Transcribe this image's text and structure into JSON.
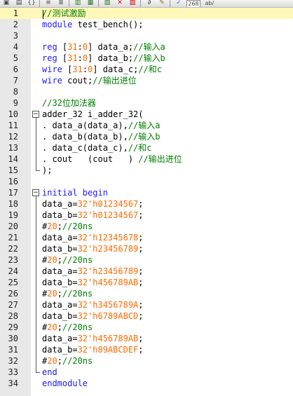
{
  "toolbar": {
    "icons": [
      "open-icon",
      "save-icon",
      "braces-icon",
      "indent-icon",
      "outdent-icon",
      "copy-icon",
      "paste-icon",
      "new-file-icon",
      "close-file-icon",
      "ftp-icon",
      "attach-icon",
      "highlight-icon",
      "check-icon",
      "calendar-icon",
      "find-replace-icon"
    ],
    "badge_label": "268",
    "find_replace_label": "ab/"
  },
  "editor": {
    "active_line": 1,
    "line_numbers": [
      "1",
      "2",
      "3",
      "4",
      "5",
      "6",
      "7",
      "8",
      "9",
      "10",
      "11",
      "12",
      "13",
      "14",
      "15",
      "16",
      "17",
      "18",
      "19",
      "20",
      "21",
      "22",
      "23",
      "24",
      "25",
      "26",
      "27",
      "28",
      "29",
      "30",
      "31",
      "32",
      "33",
      "34"
    ],
    "lines": [
      [
        {
          "t": "//测试激励",
          "c": "cm"
        }
      ],
      [
        {
          "t": "module",
          "c": "kw"
        },
        {
          "t": " test_bench();"
        }
      ],
      [],
      [
        {
          "t": "reg",
          "c": "kw"
        },
        {
          "t": " ["
        },
        {
          "t": "31",
          "c": "num"
        },
        {
          "t": ":"
        },
        {
          "t": "0",
          "c": "num"
        },
        {
          "t": "] data_a;"
        },
        {
          "t": "//输入a",
          "c": "cm"
        }
      ],
      [
        {
          "t": "reg",
          "c": "kw"
        },
        {
          "t": " ["
        },
        {
          "t": "31",
          "c": "num"
        },
        {
          "t": ":"
        },
        {
          "t": "0",
          "c": "num"
        },
        {
          "t": "] data_b;"
        },
        {
          "t": "//输入b",
          "c": "cm"
        }
      ],
      [
        {
          "t": "wire",
          "c": "kw"
        },
        {
          "t": " ["
        },
        {
          "t": "31",
          "c": "num"
        },
        {
          "t": ":"
        },
        {
          "t": "0",
          "c": "num"
        },
        {
          "t": "] data_c;"
        },
        {
          "t": "//和c",
          "c": "cm"
        }
      ],
      [
        {
          "t": "wire",
          "c": "kw"
        },
        {
          "t": " cout;"
        },
        {
          "t": "//输出进位",
          "c": "cm"
        }
      ],
      [],
      [
        {
          "t": "//32位加法器",
          "c": "cm"
        }
      ],
      [
        {
          "t": "adder_32 i_adder_32("
        }
      ],
      [
        {
          "t": ". data_a(data_a),"
        },
        {
          "t": "//输入a",
          "c": "cm"
        }
      ],
      [
        {
          "t": ". data_b(data_b),"
        },
        {
          "t": "//输入b",
          "c": "cm"
        }
      ],
      [
        {
          "t": ". data_c(data_c),"
        },
        {
          "t": "//和c",
          "c": "cm"
        }
      ],
      [
        {
          "t": ". cout   (cout   ) "
        },
        {
          "t": "//输出进位",
          "c": "cm"
        }
      ],
      [
        {
          "t": ");"
        }
      ],
      [],
      [
        {
          "t": "initial begin",
          "c": "kw"
        }
      ],
      [
        {
          "t": "data_a="
        },
        {
          "t": "32'h01234567",
          "c": "num"
        },
        {
          "t": ";"
        }
      ],
      [
        {
          "t": "data_b="
        },
        {
          "t": "32'h01234567",
          "c": "num"
        },
        {
          "t": ";"
        }
      ],
      [
        {
          "t": "#"
        },
        {
          "t": "20",
          "c": "num"
        },
        {
          "t": ";"
        },
        {
          "t": "//20ns",
          "c": "cm"
        }
      ],
      [
        {
          "t": "data_a="
        },
        {
          "t": "32'h12345678",
          "c": "num"
        },
        {
          "t": ";"
        }
      ],
      [
        {
          "t": "data_b="
        },
        {
          "t": "32'h23456789",
          "c": "num"
        },
        {
          "t": ";"
        }
      ],
      [
        {
          "t": "#"
        },
        {
          "t": "20",
          "c": "num"
        },
        {
          "t": ";"
        },
        {
          "t": "//20ns",
          "c": "cm"
        }
      ],
      [
        {
          "t": "data_a="
        },
        {
          "t": "32'h23456789",
          "c": "num"
        },
        {
          "t": ";"
        }
      ],
      [
        {
          "t": "data_b="
        },
        {
          "t": "32'h456789AB",
          "c": "num"
        },
        {
          "t": ";"
        }
      ],
      [
        {
          "t": "#"
        },
        {
          "t": "20",
          "c": "num"
        },
        {
          "t": ";"
        },
        {
          "t": "//20ns",
          "c": "cm"
        }
      ],
      [
        {
          "t": "data_a="
        },
        {
          "t": "32'h3456789A",
          "c": "num"
        },
        {
          "t": ";"
        }
      ],
      [
        {
          "t": "data_b="
        },
        {
          "t": "32'h6789ABCD",
          "c": "num"
        },
        {
          "t": ";"
        }
      ],
      [
        {
          "t": "#"
        },
        {
          "t": "20",
          "c": "num"
        },
        {
          "t": ";"
        },
        {
          "t": "//20ns",
          "c": "cm"
        }
      ],
      [
        {
          "t": "data_a="
        },
        {
          "t": "32'h456789AB",
          "c": "num"
        },
        {
          "t": ";"
        }
      ],
      [
        {
          "t": "data_b="
        },
        {
          "t": "32'h89ABCDEF",
          "c": "num"
        },
        {
          "t": ";"
        }
      ],
      [
        {
          "t": "#"
        },
        {
          "t": "20",
          "c": "num"
        },
        {
          "t": ";"
        },
        {
          "t": "//20ns",
          "c": "cm"
        }
      ],
      [
        {
          "t": "end",
          "c": "kw"
        }
      ],
      [
        {
          "t": "endmodule",
          "c": "kw"
        }
      ]
    ]
  },
  "colors": {
    "keyword": "#1a1aff",
    "comment": "#008000",
    "number": "#ff6a00",
    "active_line": "#fff8b8",
    "gutter": "#e8e8e8"
  }
}
